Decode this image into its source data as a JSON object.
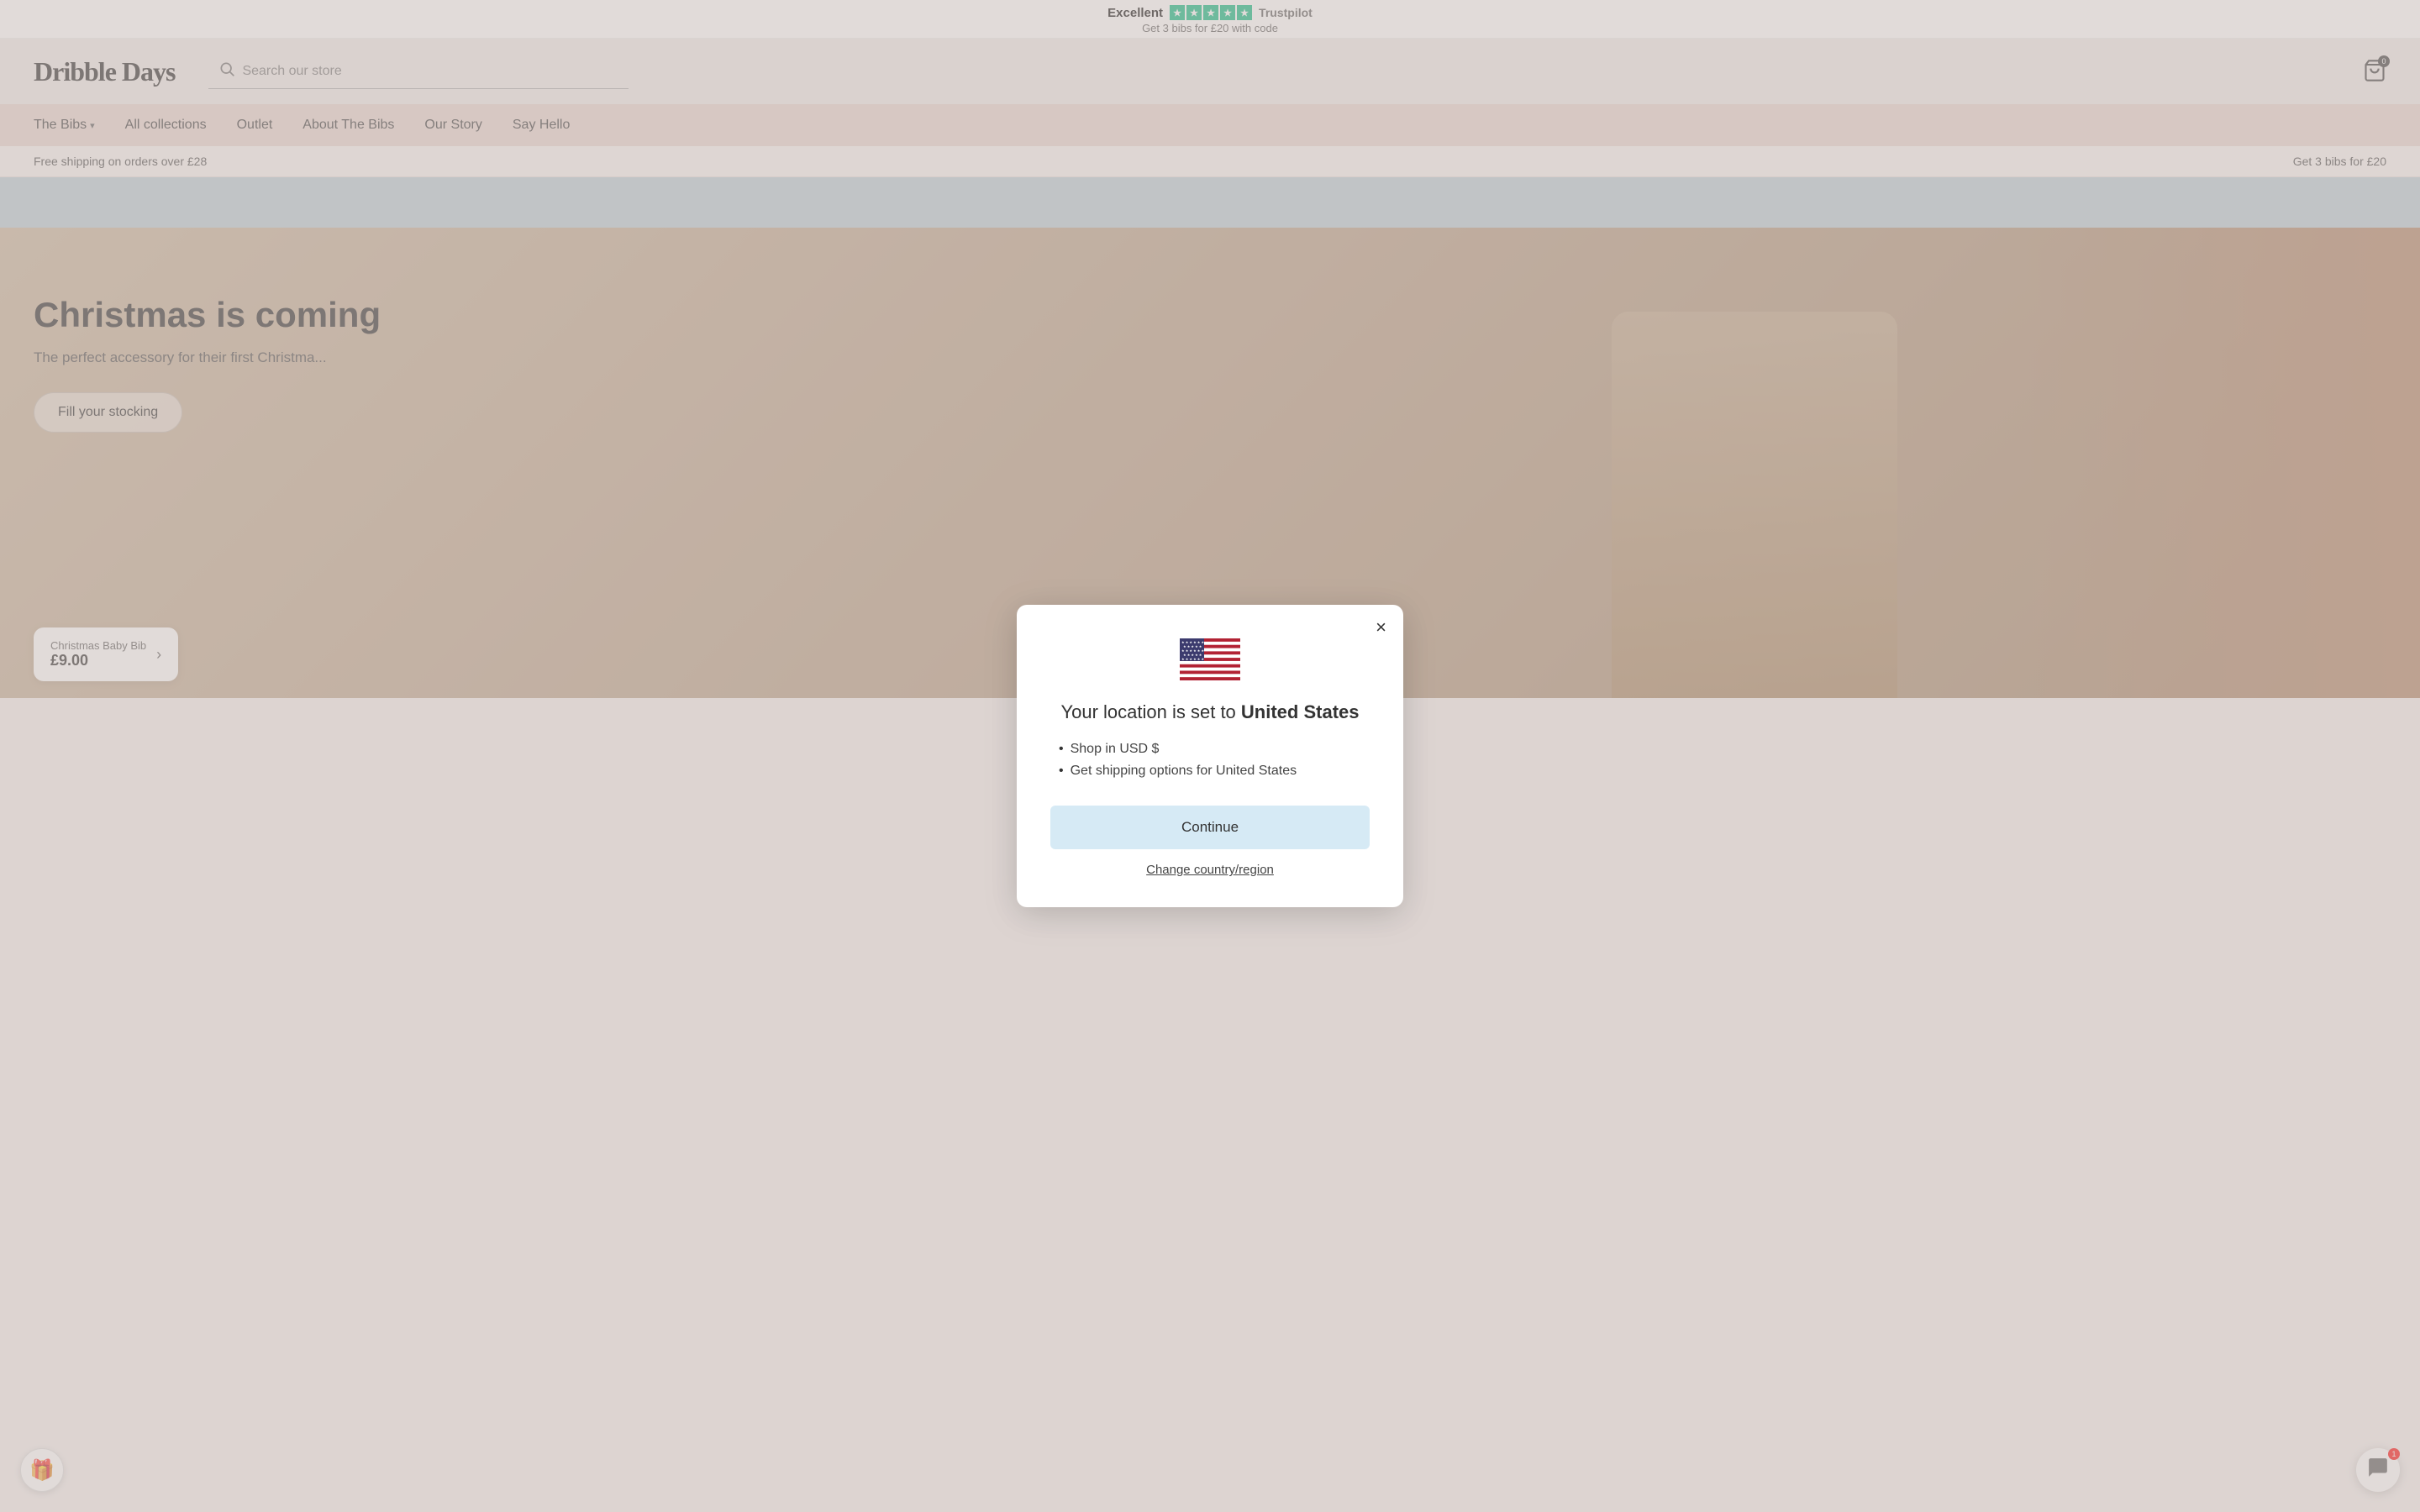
{
  "trust_bar": {
    "excellent_label": "Excellent",
    "trustpilot_label": "Trustpilot",
    "promo_text": "Get 3 bibs for £20 with code"
  },
  "header": {
    "logo": "Dribble Days",
    "search_placeholder": "Search our store",
    "cart_count": "0"
  },
  "nav": {
    "items": [
      {
        "label": "The Bibs",
        "has_dropdown": true
      },
      {
        "label": "All collections",
        "has_dropdown": false
      },
      {
        "label": "Outlet",
        "has_dropdown": false
      },
      {
        "label": "About The Bibs",
        "has_dropdown": false
      },
      {
        "label": "Our Story",
        "has_dropdown": false
      },
      {
        "label": "Say Hello",
        "has_dropdown": false
      }
    ]
  },
  "promo_bar": {
    "left_text": "Free shipping on orders over £28",
    "right_text": "Get 3 bibs for £20"
  },
  "hero": {
    "title": "Christmas is coming",
    "subtitle": "The perfect accessory for their first Christma...",
    "cta_button": "Fill your stocking",
    "product_name": "Christmas Baby Bib",
    "product_price": "£9.00"
  },
  "modal": {
    "title_prefix": "Your location is set to ",
    "location": "United States",
    "bullet_1": "Shop in USD $",
    "bullet_2": "Get shipping options for United States",
    "continue_label": "Continue",
    "change_region_label": "Change country/region",
    "close_label": "×"
  },
  "gift_icon": "🎁",
  "chat_icon": "💬",
  "chat_badge": "1"
}
